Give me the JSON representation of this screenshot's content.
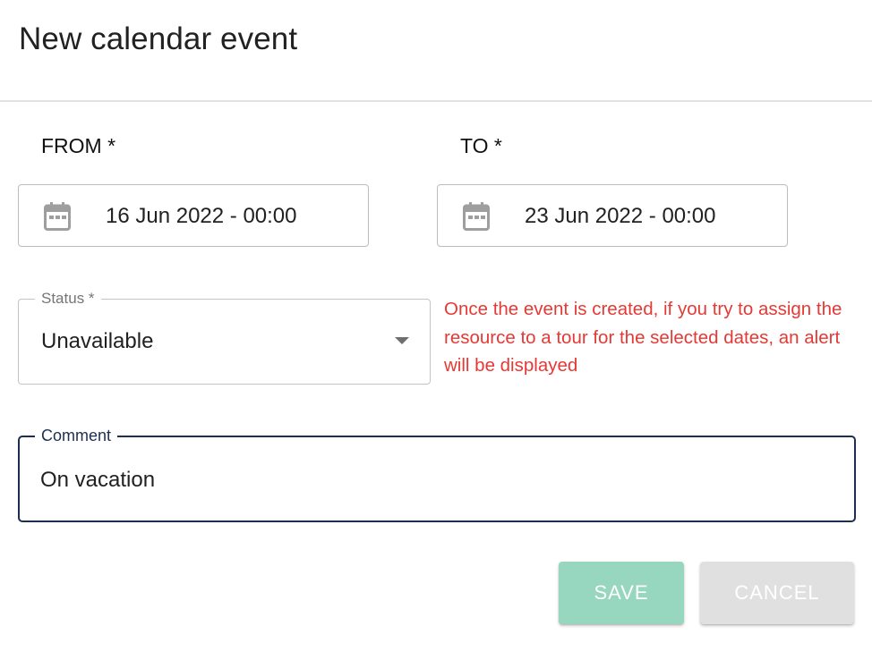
{
  "dialog": {
    "title": "New calendar event"
  },
  "from": {
    "label": "FROM *",
    "value": "16 Jun 2022 - 00:00",
    "icon": "calendar-icon"
  },
  "to": {
    "label": "TO *",
    "value": "23 Jun 2022 - 00:00",
    "icon": "calendar-icon"
  },
  "status": {
    "label": "Status *",
    "value": "Unavailable",
    "icon": "chevron-down-icon"
  },
  "warning": {
    "text": "Once the event is created, if you try to assign the resource to a tour for the selected dates, an alert will be displayed",
    "color": "#e53935"
  },
  "comment": {
    "label": "Comment",
    "value": "On vacation",
    "border_color": "#1d2f4f"
  },
  "actions": {
    "save_label": "SAVE",
    "cancel_label": "CANCEL",
    "save_color": "#97d6bf",
    "cancel_color": "#e0e0e0"
  }
}
